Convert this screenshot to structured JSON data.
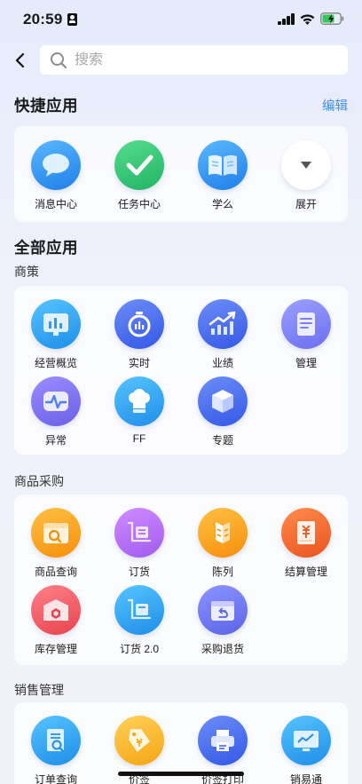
{
  "status_bar": {
    "time": "20:59",
    "battery_color": "#34c759"
  },
  "top_bar": {
    "search_placeholder": "搜索"
  },
  "quick_apps": {
    "title": "快捷应用",
    "edit_label": "编辑",
    "items": [
      {
        "label": "消息中心",
        "icon": "chat-bubble-icon",
        "color": "#2f8ef0"
      },
      {
        "label": "任务中心",
        "icon": "checkmark-icon",
        "color": "#2ec471"
      },
      {
        "label": "学么",
        "icon": "open-book-icon",
        "color": "#2f8ef0"
      },
      {
        "label": "展开",
        "icon": "expand-triangle-icon",
        "color": "#ffffff"
      }
    ]
  },
  "all_apps": {
    "title": "全部应用",
    "groups": [
      {
        "label": "商策",
        "items": [
          {
            "label": "经营概览",
            "icon": "bar-chart-board-icon",
            "color": "#2a9bf2"
          },
          {
            "label": "实时",
            "icon": "stopwatch-icon",
            "color": "#4a6ff0"
          },
          {
            "label": "业绩",
            "icon": "trend-chart-icon",
            "color": "#4a6ff0"
          },
          {
            "label": "管理",
            "icon": "document-icon",
            "color": "#7b7ff3"
          },
          {
            "label": "异常",
            "icon": "heartbeat-icon",
            "color": "#7a72ee"
          },
          {
            "label": "FF",
            "icon": "chef-hat-icon",
            "color": "#2a9bf2"
          },
          {
            "label": "专题",
            "icon": "cube-icon",
            "color": "#4a6ff0"
          }
        ]
      },
      {
        "label": "商品采购",
        "items": [
          {
            "label": "商品查询",
            "icon": "box-search-icon",
            "color": "#fba11d"
          },
          {
            "label": "订货",
            "icon": "cart-order-icon",
            "color": "#b56cf0"
          },
          {
            "label": "陈列",
            "icon": "shelf-icon",
            "color": "#fba11d"
          },
          {
            "label": "结算管理",
            "icon": "settlement-icon",
            "color": "#f26b3a"
          },
          {
            "label": "库存管理",
            "icon": "warehouse-icon",
            "color": "#f05a63"
          },
          {
            "label": "订货 2.0",
            "icon": "cart-order-icon",
            "color": "#2a9bf2"
          },
          {
            "label": "采购退货",
            "icon": "return-box-icon",
            "color": "#6d78ef"
          }
        ]
      },
      {
        "label": "销售管理",
        "items": [
          {
            "label": "订单查询",
            "icon": "order-search-icon",
            "color": "#2a9bf2"
          },
          {
            "label": "价签",
            "icon": "price-tag-icon",
            "color": "#fbb11d"
          },
          {
            "label": "价签打印",
            "icon": "printer-icon",
            "color": "#4a6ff0"
          },
          {
            "label": "销易通",
            "icon": "monitor-chart-icon",
            "color": "#2a9bf2"
          }
        ]
      }
    ]
  }
}
